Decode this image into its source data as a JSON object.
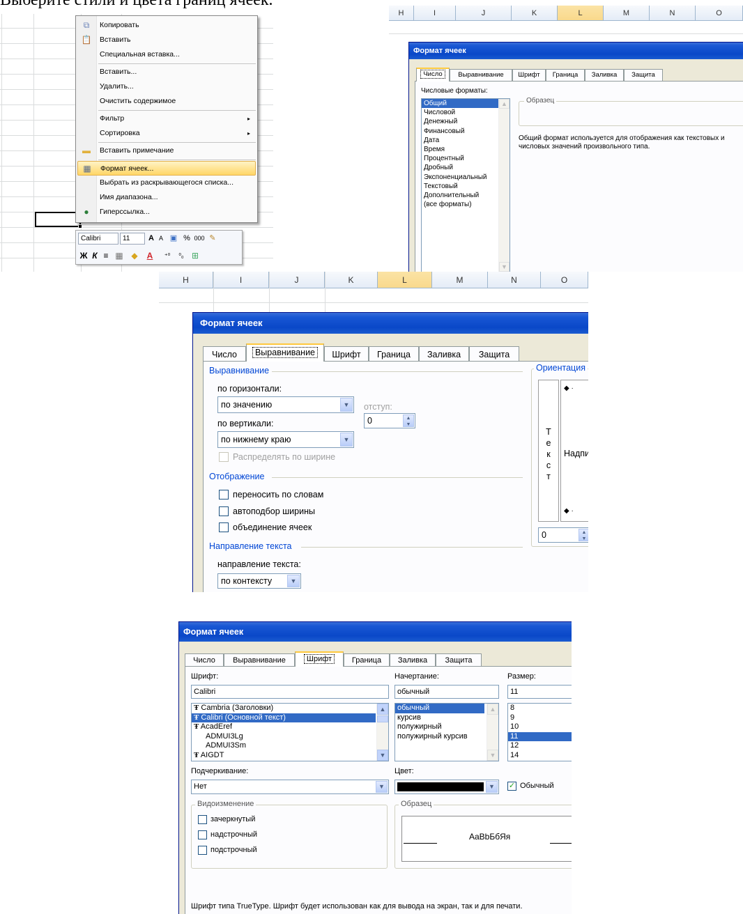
{
  "header_text": "Выберите стили и цвета границ ячеек.",
  "context_menu": {
    "items": [
      {
        "label": "Копировать",
        "icon": "copy-icon"
      },
      {
        "label": "Вставить",
        "icon": "paste-icon"
      },
      {
        "label": "Специальная вставка..."
      },
      {
        "label": "Вставить..."
      },
      {
        "label": "Удалить..."
      },
      {
        "label": "Очистить содержимое"
      },
      {
        "label": "Фильтр"
      },
      {
        "label": "Сортировка"
      },
      {
        "label": "Вставить примечание",
        "icon": "comment-icon"
      },
      {
        "label": "Формат ячеек...",
        "icon": "format-cells-icon"
      },
      {
        "label": "Выбрать из раскрывающегося списка..."
      },
      {
        "label": "Имя диапазона..."
      },
      {
        "label": "Гиперссылка...",
        "icon": "hyperlink-icon"
      }
    ],
    "submenu_arrow": "▸"
  },
  "mini_toolbar": {
    "font": "Calibri",
    "size": "11",
    "grow": "A",
    "shrink": "A",
    "percent": "%",
    "thousands": "000",
    "bold": "Ж",
    "italic": "К",
    "align": "≡",
    "font_color": "A",
    "inc_decimal": "",
    "dec_decimal": ""
  },
  "columns_a": [
    "H",
    "I",
    "J",
    "K",
    "L",
    "M",
    "N",
    "O"
  ],
  "columns_b": [
    "H",
    "I",
    "J",
    "K",
    "L",
    "M",
    "N",
    "O"
  ],
  "dialog_title": "Формат ячеек",
  "tabs": [
    "Число",
    "Выравнивание",
    "Шрифт",
    "Граница",
    "Заливка",
    "Защита"
  ],
  "number_tab": {
    "formats_label": "Числовые форматы:",
    "formats": [
      "Общий",
      "Числовой",
      "Денежный",
      "Финансовый",
      "Дата",
      "Время",
      "Процентный",
      "Дробный",
      "Экспоненциальный",
      "Текстовый",
      "Дополнительный",
      "(все форматы)"
    ],
    "selected": "Общий",
    "sample_label": "Образец",
    "description": "Общий формат используется для отображения как текстовых и числовых значений произвольного типа."
  },
  "align_tab": {
    "group_align": "Выравнивание",
    "horizontal_label": "по горизонтали:",
    "horizontal_value": "по значению",
    "indent_label": "отступ:",
    "indent_value": "0",
    "vertical_label": "по вертикали:",
    "vertical_value": "по нижнему краю",
    "distribute_label": "Распределять по ширине",
    "group_display": "Отображение",
    "wrap_label": "переносить по словам",
    "autofit_label": "автоподбор ширины",
    "merge_label": "объединение ячеек",
    "group_direction": "Направление текста",
    "direction_label": "направление текста:",
    "direction_value": "по контексту",
    "orientation_label": "Ориентация",
    "vertical_text": [
      "Т",
      "е",
      "к",
      "с",
      "т"
    ],
    "orientation_text": "Надпись",
    "degrees_value": "0"
  },
  "font_tab": {
    "font_label": "Шрифт:",
    "font_value": "Calibri",
    "fonts": [
      "Cambria (Заголовки)",
      "Calibri (Основной текст)",
      "AcadEref",
      "ADMUI3Lg",
      "ADMUI3Sm",
      "AIGDT"
    ],
    "selected_font": "Calibri (Основной текст)",
    "style_label": "Начертание:",
    "style_value": "обычный",
    "styles": [
      "обычный",
      "курсив",
      "полужирный",
      "полужирный курсив"
    ],
    "size_label": "Размер:",
    "size_value": "11",
    "sizes": [
      "8",
      "9",
      "10",
      "11",
      "12",
      "14"
    ],
    "underline_label": "Подчеркивание:",
    "underline_value": "Нет",
    "color_label": "Цвет:",
    "normal_label": "Обычный",
    "effects_label": "Видоизменение",
    "strike_label": "зачеркнутый",
    "super_label": "надстрочный",
    "sub_label": "подстрочный",
    "sample_label": "Образец",
    "sample_text": "AaBbБбЯя",
    "truetype_note": "Шрифт типа TrueType. Шрифт будет использован как для вывода на экран, так и для печати."
  },
  "colors": {
    "title_bar": "#0a48c8",
    "selection": "#316ac5",
    "menu_highlight": "#ffd667",
    "selected_column": "#f9d98c"
  }
}
